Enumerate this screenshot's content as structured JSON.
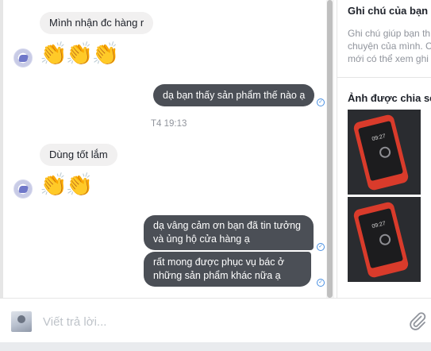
{
  "messages": {
    "received_1": "Mình nhận đc hàng r",
    "claps_1": "👏👏👏",
    "sent_1": "dạ bạn thấy sản phẩm thế nào ạ",
    "timestamp": "T4 19:13",
    "received_2": "Dùng tốt lắm",
    "claps_2": "👏👏",
    "sent_2": "dạ vâng cảm ơn bạn đã tin tưởng và ủng hộ cửa hàng ạ",
    "sent_3": "rất mong được phục vụ bác ở những sản phẩm khác nữa ạ"
  },
  "side_panel": {
    "notes_title": "Ghi chú của bạn",
    "notes_desc_line1": "Ghi chú giúp bạn th",
    "notes_desc_line2": "chuyện của mình. C",
    "notes_desc_line3": "mới có thể xem ghi",
    "shared_title": "Ảnh được chia sẻ",
    "phone_time": "09:27"
  },
  "composer": {
    "placeholder": "Viết trả lời..."
  },
  "colors": {
    "outgoing_bubble": "#4b4f56",
    "incoming_bubble": "#f1f0f0",
    "seen_check": "#4a90e2"
  }
}
